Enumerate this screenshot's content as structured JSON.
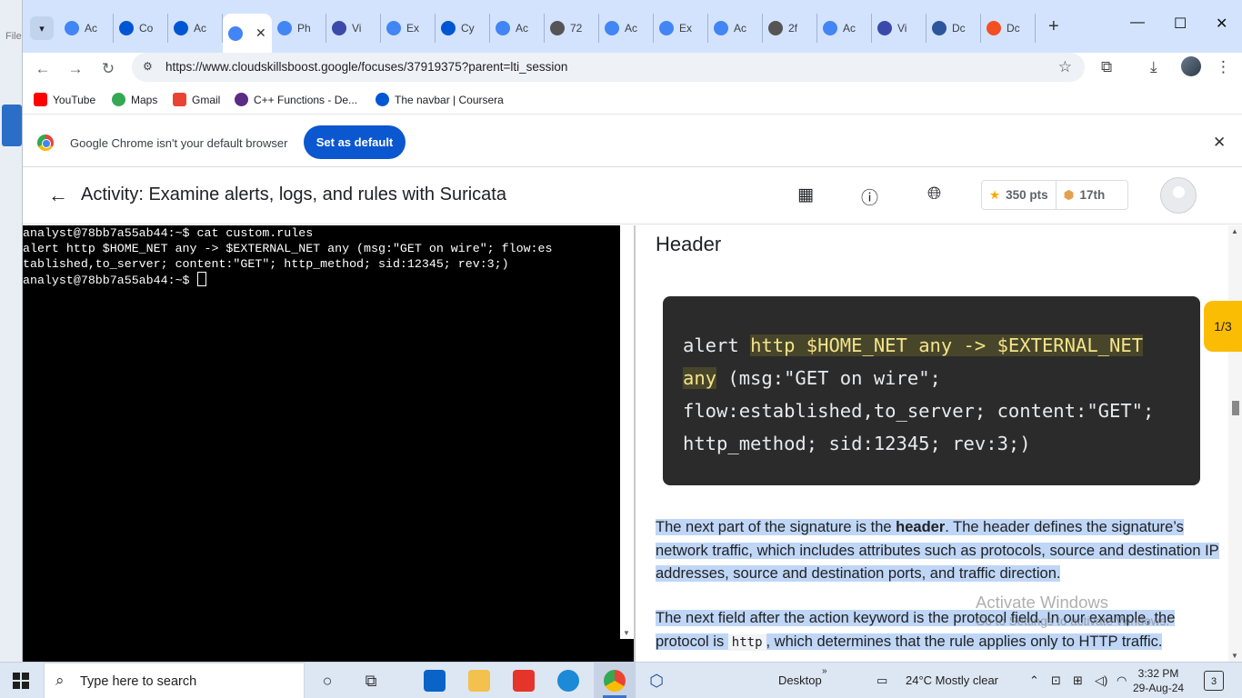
{
  "background_app": {
    "menu_text": "File"
  },
  "browser": {
    "tabs": [
      {
        "label": "Ac",
        "icon": "google-cloud-icon",
        "color": "#4285f4"
      },
      {
        "label": "Co",
        "icon": "coursera-icon",
        "color": "#0056d2"
      },
      {
        "label": "Ac",
        "icon": "coursera-icon",
        "color": "#0056d2"
      },
      {
        "label": "",
        "icon": "google-cloud-icon",
        "color": "#4285f4",
        "active": true
      },
      {
        "label": "Ph",
        "icon": "docs-icon",
        "color": "#4285f4"
      },
      {
        "label": "Vi",
        "icon": "sigma-icon",
        "color": "#3b4aaa"
      },
      {
        "label": "Ex",
        "icon": "google-cloud-icon",
        "color": "#4285f4"
      },
      {
        "label": "Cy",
        "icon": "coursera-icon",
        "color": "#0056d2"
      },
      {
        "label": "Ac",
        "icon": "google-cloud-icon",
        "color": "#4285f4"
      },
      {
        "label": "72",
        "icon": "globe-icon",
        "color": "#555555"
      },
      {
        "label": "Ac",
        "icon": "google-cloud-icon",
        "color": "#4285f4"
      },
      {
        "label": "Ex",
        "icon": "google-cloud-icon",
        "color": "#4285f4"
      },
      {
        "label": "Ac",
        "icon": "google-cloud-icon",
        "color": "#4285f4"
      },
      {
        "label": "2f",
        "icon": "globe-icon",
        "color": "#555555"
      },
      {
        "label": "Ac",
        "icon": "google-cloud-icon",
        "color": "#4285f4"
      },
      {
        "label": "Vi",
        "icon": "sigma-icon",
        "color": "#3b4aaa"
      },
      {
        "label": "Dc",
        "icon": "word-icon",
        "color": "#2b579a"
      },
      {
        "label": "Dc",
        "icon": "microsoft-icon",
        "color": "#f25022"
      }
    ],
    "url": "https://www.cloudskillsboost.google/focuses/37919375?parent=lti_session",
    "bookmarks": [
      {
        "label": "YouTube",
        "icon": "youtube-icon",
        "color": "#ff0000"
      },
      {
        "label": "Maps",
        "icon": "maps-icon",
        "color": "#34a853"
      },
      {
        "label": "Gmail",
        "icon": "gmail-icon",
        "color": "#ea4335"
      },
      {
        "label": "C++ Functions - De...",
        "icon": "st-icon",
        "color": "#5b2c83"
      },
      {
        "label": "The navbar | Coursera",
        "icon": "coursera-icon",
        "color": "#0056d2"
      }
    ],
    "infobar": {
      "message": "Google Chrome isn't your default browser",
      "button": "Set as default"
    }
  },
  "app": {
    "title": "Activity: Examine alerts, logs, and rules with Suricata",
    "points": "350 pts",
    "rank": "17th"
  },
  "terminal": {
    "lines": [
      "analyst@78bb7a55ab44:~$ cat custom.rules",
      "alert http $HOME_NET any -> $EXTERNAL_NET any (msg:\"GET on wire\"; flow:es",
      "tablished,to_server; content:\"GET\"; http_method; sid:12345; rev:3;)",
      "analyst@78bb7a55ab44:~$ "
    ]
  },
  "content": {
    "heading": "Header",
    "code": {
      "action": "alert ",
      "header_1": "http $HOME_NET any -> $EXTERNAL_NET",
      "header_2": "any",
      "rest_1": " (msg:\"GET on wire\";",
      "rest_2": "flow:established,to_server; content:\"GET\";",
      "rest_3": "http_method; sid:12345; rev:3;)"
    },
    "para1_a": "The next part of the signature is the ",
    "para1_b": "header",
    "para1_c": ". The header defines the signature’s network traffic, which includes attributes such as protocols, source and destination IP addresses, source and destination ports, and traffic direction.",
    "para2_a": "The next field after the action keyword is the protocol field. In our example, the protocol is ",
    "para2_code": "http",
    "para2_b": ", which determines that the rule applies only to HTTP traffic.",
    "pager": "1/3",
    "watermark_1": "Activate Windows",
    "watermark_2": "Go to Settings to activate Windows."
  },
  "taskbar": {
    "search_placeholder": "Type here to search",
    "desktop_label": "Desktop",
    "weather": "24°C  Mostly clear",
    "time": "3:32 PM",
    "date": "29-Aug-24",
    "notifications": "3"
  }
}
